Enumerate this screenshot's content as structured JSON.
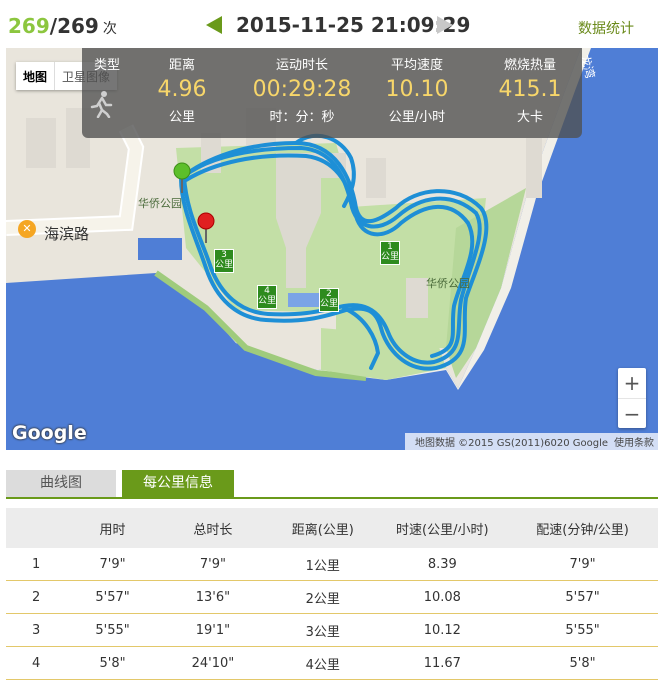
{
  "header": {
    "current": "269",
    "separator": "/",
    "total": "269",
    "unit": "次",
    "datetime": "2015-11-25 21:09:29",
    "stats_link": "数据统计"
  },
  "map": {
    "type_buttons": [
      "地图",
      "卫星图像"
    ],
    "park_label_1": "华侨公园",
    "park_label_2": "华侨公园",
    "road_label": "海滨路",
    "road_label_2": "龙湾",
    "google_logo": "Google",
    "attribution": "地图数据 ©2015 GS(2011)6020 Google",
    "terms": "使用条款",
    "markers": [
      "1",
      "2",
      "3",
      "4"
    ],
    "marker_sub": "公里"
  },
  "summary": {
    "headers": [
      "类型",
      "距离",
      "运动时长",
      "平均速度",
      "燃烧热量"
    ],
    "values": [
      "4.96",
      "00:29:28",
      "10.10",
      "415.1"
    ],
    "units": [
      "公里",
      "时：分：秒",
      "公里/小时",
      "大卡"
    ],
    "activity_icon": "runner-icon"
  },
  "tabs": [
    "曲线图",
    "每公里信息"
  ],
  "table": {
    "headers": [
      "",
      "用时",
      "总时长",
      "距离(公里)",
      "时速(公里/小时)",
      "配速(分钟/公里)"
    ],
    "rows": [
      [
        "1",
        "7'9\"",
        "7'9\"",
        "1公里",
        "8.39",
        "7'9\""
      ],
      [
        "2",
        "5'57\"",
        "13'6\"",
        "2公里",
        "10.08",
        "5'57\""
      ],
      [
        "3",
        "5'55\"",
        "19'1\"",
        "3公里",
        "10.12",
        "5'55\""
      ],
      [
        "4",
        "5'8\"",
        "24'10\"",
        "4公里",
        "11.67",
        "5'8\""
      ]
    ]
  },
  "colors": {
    "accent": "#6a9a1a",
    "count_current": "#8cc63f",
    "value_yellow": "#f7d66a",
    "route": "#1e8fd6",
    "water": "#4f7ed6",
    "park": "#c3dfa6"
  }
}
